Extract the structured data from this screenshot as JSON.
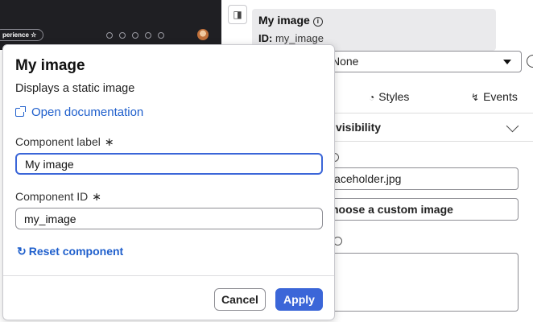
{
  "preview": {
    "pill_label": "perience ☆",
    "icons": [
      "search-icon",
      "dot-icon",
      "link-icon",
      "help-icon",
      "bell-icon"
    ]
  },
  "panel": {
    "title": "My image",
    "info_glyph": "i",
    "id_prefix": "ID:",
    "id_value": "my_image",
    "select_value": "None",
    "tabs": [
      {
        "label": "Styles",
        "icon": "palette-icon"
      },
      {
        "label": "Events",
        "icon": "bolt-icon"
      }
    ],
    "section_title": "visibility",
    "source_value": "laceholder.jpg",
    "choose_label": "hoose a custom image"
  },
  "popover": {
    "title": "My image",
    "description": "Displays a static image",
    "doc_link": "Open documentation",
    "label_field": {
      "label": "Component label",
      "required": "∗",
      "value": "My image"
    },
    "id_field": {
      "label": "Component ID",
      "required": "∗",
      "value": "my_image"
    },
    "reset_label": "Reset component",
    "cancel_label": "Cancel",
    "apply_label": "Apply"
  },
  "colors": {
    "accent": "#3b66d8",
    "link": "#1f5fcc",
    "preview_bg": "#1f1f23",
    "header_bg": "#eaeaec"
  }
}
